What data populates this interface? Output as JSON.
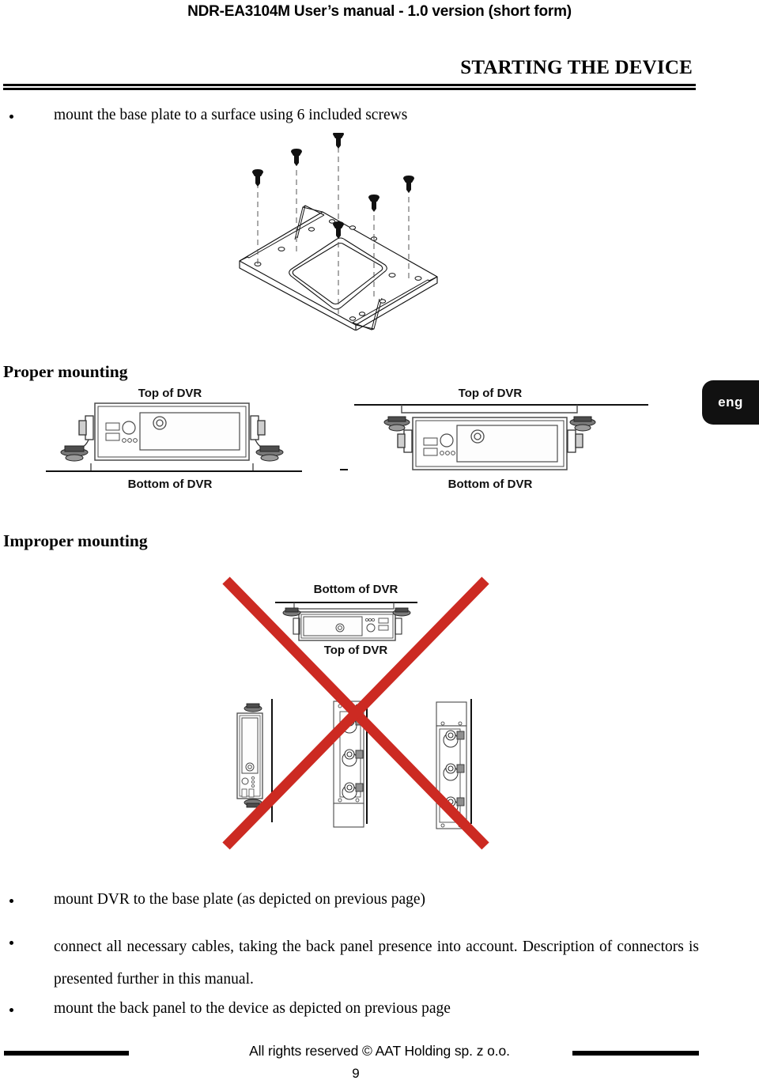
{
  "document": {
    "running_header": "NDR-EA3104M User’s manual - 1.0 version (short form)",
    "section_title": "STARTING THE DEVICE",
    "language_tab": "eng",
    "footer_copyright": "All rights reserved © AAT Holding sp. z o.o.",
    "page_number": "9"
  },
  "bullets": {
    "top": "mount the base plate to a surface using 6 included screws",
    "b1": "mount DVR to the base plate (as depicted on previous page)",
    "b2": "connect all necessary cables, taking the back panel presence into account. Description of connectors is presented further in this manual.",
    "b3": "mount the back panel to the device as depicted on previous page"
  },
  "figures": {
    "base_plate": {
      "heading": "",
      "screw_count": 6
    },
    "proper": {
      "heading": "Proper mounting",
      "left_top_label": "Top of DVR",
      "left_bottom_label": "Bottom of DVR",
      "right_top_label": "Top of DVR",
      "right_bottom_label": "Bottom of DVR"
    },
    "improper": {
      "heading": "Improper mounting",
      "top_label": "Bottom of DVR",
      "bottom_label": "Top of DVR",
      "cross_color": "#CC2A22"
    }
  },
  "colors": {
    "text": "#000000",
    "background": "#FFFFFF",
    "accent_red": "#CC2A22",
    "tab_background": "#111111",
    "line_gray": "#4A4A4A"
  }
}
